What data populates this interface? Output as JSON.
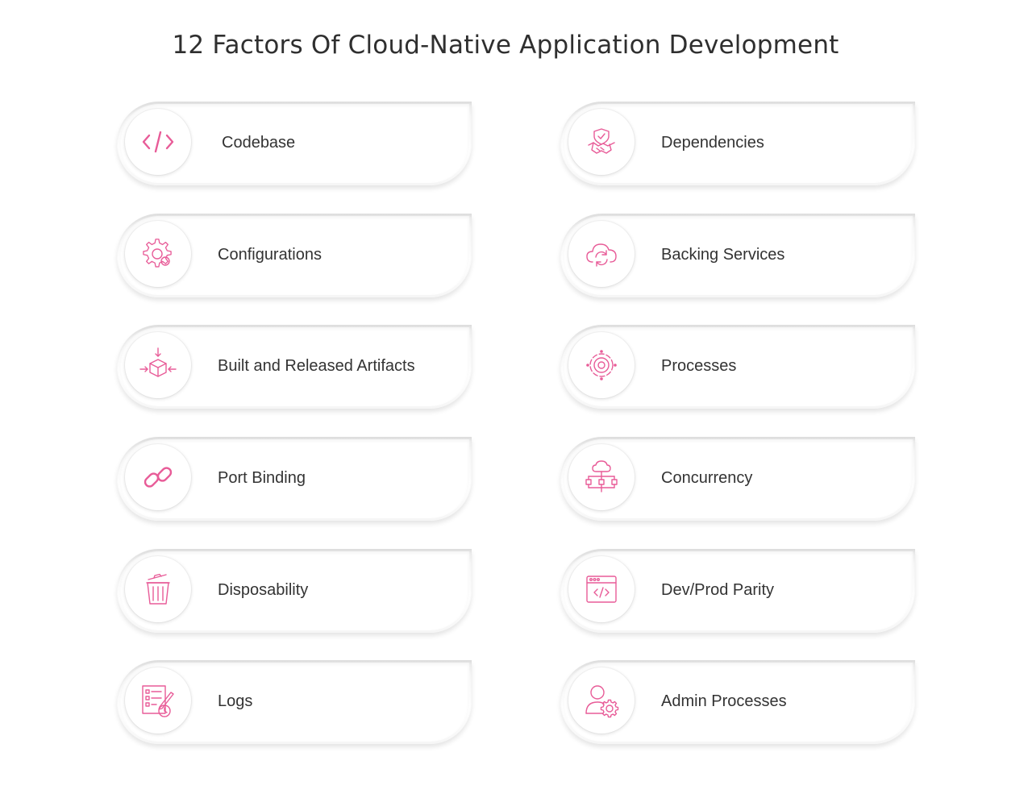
{
  "title": "12 Factors Of Cloud-Native Application Development",
  "accent_color": "#e85c98",
  "factors": [
    {
      "label": "Codebase",
      "icon": "code-brackets-icon"
    },
    {
      "label": "Dependencies",
      "icon": "handshake-shield-icon"
    },
    {
      "label": "Configurations",
      "icon": "gears-icon"
    },
    {
      "label": "Backing Services",
      "icon": "cloud-sync-icon"
    },
    {
      "label": "Built and Released Artifacts",
      "icon": "box-arrows-icon"
    },
    {
      "label": "Processes",
      "icon": "gear-cycle-icon"
    },
    {
      "label": "Port Binding",
      "icon": "chain-link-icon"
    },
    {
      "label": "Concurrency",
      "icon": "cloud-network-icon"
    },
    {
      "label": "Disposability",
      "icon": "trash-can-icon"
    },
    {
      "label": "Dev/Prod Parity",
      "icon": "browser-code-icon"
    },
    {
      "label": "Logs",
      "icon": "checklist-pen-icon"
    },
    {
      "label": "Admin Processes",
      "icon": "user-gear-icon"
    }
  ]
}
